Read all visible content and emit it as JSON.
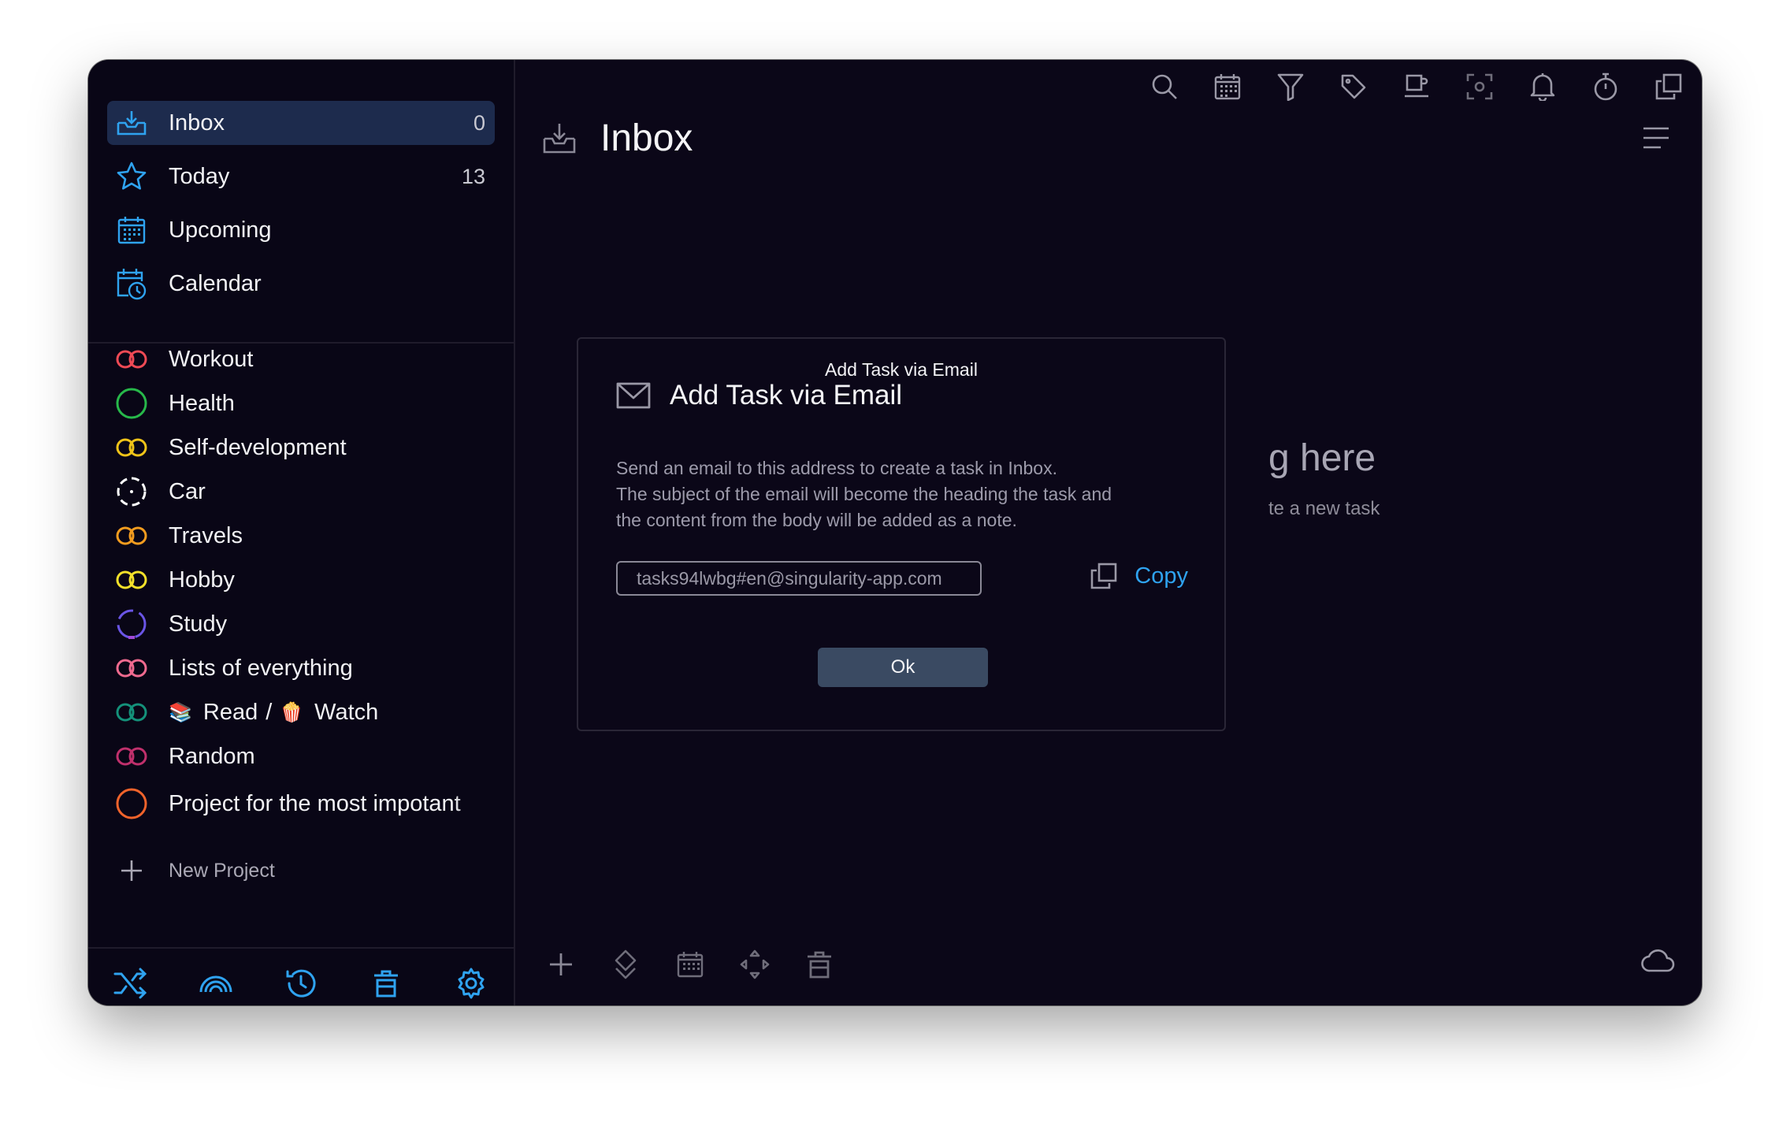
{
  "sidebar": {
    "nav": [
      {
        "label": "Inbox",
        "count": "0",
        "icon": "inbox-icon"
      },
      {
        "label": "Today",
        "count": "13",
        "icon": "star-icon"
      },
      {
        "label": "Upcoming",
        "count": "",
        "icon": "calendar-grid-icon"
      },
      {
        "label": "Calendar",
        "count": "",
        "icon": "calendar-clock-icon"
      }
    ],
    "projects": [
      {
        "label": "Workout",
        "color": "#ef4a55",
        "icon": "project-rings-icon"
      },
      {
        "label": "Health",
        "color": "#27b84a",
        "icon": "project-circle-icon"
      },
      {
        "label": "Self-development",
        "color": "#f0c419",
        "icon": "project-rings-icon"
      },
      {
        "label": "Car",
        "color": "#ffffff",
        "icon": "project-dashed-circle-icon"
      },
      {
        "label": "Travels",
        "color": "#f39c1f",
        "icon": "project-rings-icon"
      },
      {
        "label": "Hobby",
        "color": "#f4e12a",
        "icon": "project-rings-icon"
      },
      {
        "label": "Study",
        "color": "#6a55e6",
        "icon": "project-dashed-circle-icon"
      },
      {
        "label": "Lists of everything",
        "color": "#f06a8f",
        "icon": "project-rings-icon"
      },
      {
        "label_a": "Read",
        "separator": "/",
        "label_b": "Watch",
        "emoji_a": "📚",
        "emoji_b": "🍿",
        "color": "#14917a",
        "icon": "project-rings-icon"
      },
      {
        "label": "Random",
        "color": "#c0306c",
        "icon": "project-rings-icon"
      },
      {
        "label": "Project for the most impotant",
        "color": "#f0632b",
        "icon": "project-circle-icon"
      }
    ],
    "new_project": "New Project",
    "bottom_tools": [
      "shuffle-icon",
      "rainbow-icon",
      "history-icon",
      "trash-icon",
      "settings-gear-icon"
    ]
  },
  "main": {
    "title": "Inbox",
    "empty_title_partial": "g here",
    "empty_sub_partial": "te a new task",
    "topbar_icons": [
      "search-icon",
      "calendar-icon",
      "filter-icon",
      "tag-icon",
      "coffee-icon",
      "focus-icon",
      "bell-icon",
      "timer-icon",
      "copy-window-icon"
    ]
  },
  "dialog": {
    "window_title": "Add Task via Email",
    "heading": "Add Task via Email",
    "desc_lines": [
      "Send an email to this address to create a task in Inbox.",
      "The subject of the email will become the heading the task and",
      "the content from the body will be added as a note."
    ],
    "email": "tasks94lwbg#en@singularity-app.com",
    "copy_label": "Copy",
    "ok_label": "Ok"
  },
  "colors": {
    "accent": "#2fa3f0",
    "background": "#0b0718",
    "active_item": "#1d2b4d"
  }
}
